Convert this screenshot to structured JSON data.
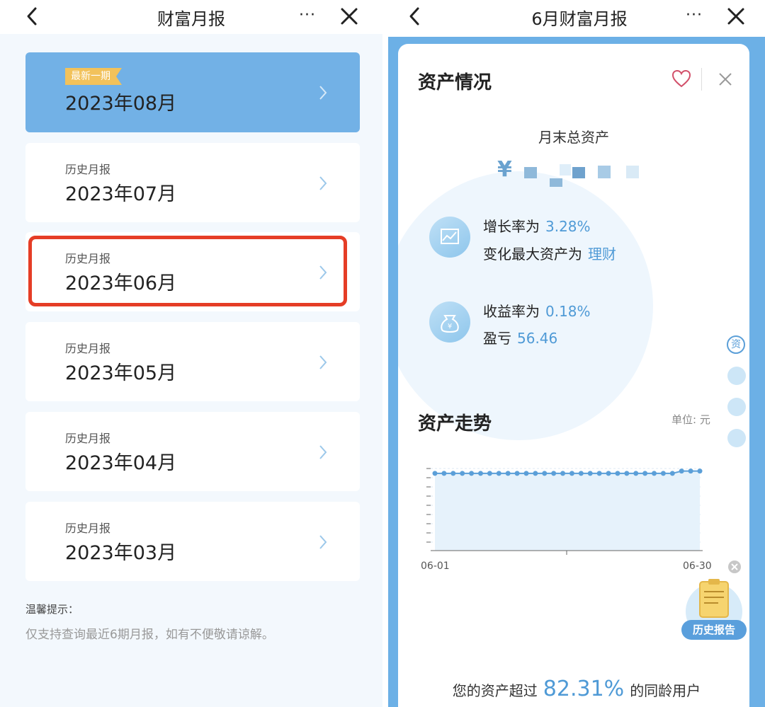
{
  "left": {
    "nav": {
      "title": "财富月报",
      "more": "···"
    },
    "latest": {
      "badge": "最新一期",
      "month": "2023年08月"
    },
    "history": [
      {
        "sub": "历史月报",
        "month": "2023年07月"
      },
      {
        "sub": "历史月报",
        "month": "2023年06月"
      },
      {
        "sub": "历史月报",
        "month": "2023年05月"
      },
      {
        "sub": "历史月报",
        "month": "2023年04月"
      },
      {
        "sub": "历史月报",
        "month": "2023年03月"
      }
    ],
    "tip": {
      "title": "温馨提示：",
      "text": "仅支持查询最近6期月报，如有不便敬请谅解。"
    }
  },
  "right": {
    "nav": {
      "title": "6月财富月报",
      "more": "···"
    },
    "asset_section": {
      "title": "资产情况",
      "total_label": "月末总资产",
      "currency": "¥",
      "growth_label": "增长率为",
      "growth_value": "3.28%",
      "max_change_label": "变化最大资产为",
      "max_change_value": "理财",
      "yield_label": "收益率为",
      "yield_value": "0.18%",
      "pnl_label": "盈亏",
      "pnl_value": "56.46"
    },
    "side_nav": {
      "active": "资"
    },
    "trend_section": {
      "title": "资产走势",
      "unit": "单位: 元",
      "x_start": "06-01",
      "x_end": "06-30",
      "history_button": "历史报告"
    },
    "footer": {
      "prefix": "您的资产超过",
      "percent": "82.31%",
      "suffix": "的同龄用户"
    }
  },
  "chart_data": {
    "type": "line",
    "x": [
      "06-01",
      "06-02",
      "06-03",
      "06-04",
      "06-05",
      "06-06",
      "06-07",
      "06-08",
      "06-09",
      "06-10",
      "06-11",
      "06-12",
      "06-13",
      "06-14",
      "06-15",
      "06-16",
      "06-17",
      "06-18",
      "06-19",
      "06-20",
      "06-21",
      "06-22",
      "06-23",
      "06-24",
      "06-25",
      "06-26",
      "06-27",
      "06-28",
      "06-29",
      "06-30"
    ],
    "values": [
      100,
      100,
      100,
      100,
      100,
      100,
      100,
      100,
      100,
      100,
      100,
      100,
      100,
      100,
      100,
      100,
      100,
      100,
      100,
      100,
      100,
      100,
      100,
      100,
      100,
      100,
      100,
      103,
      103,
      103
    ],
    "xlabel": "",
    "ylabel": "",
    "tick_labels_x": [
      "06-01",
      "06-30"
    ]
  }
}
